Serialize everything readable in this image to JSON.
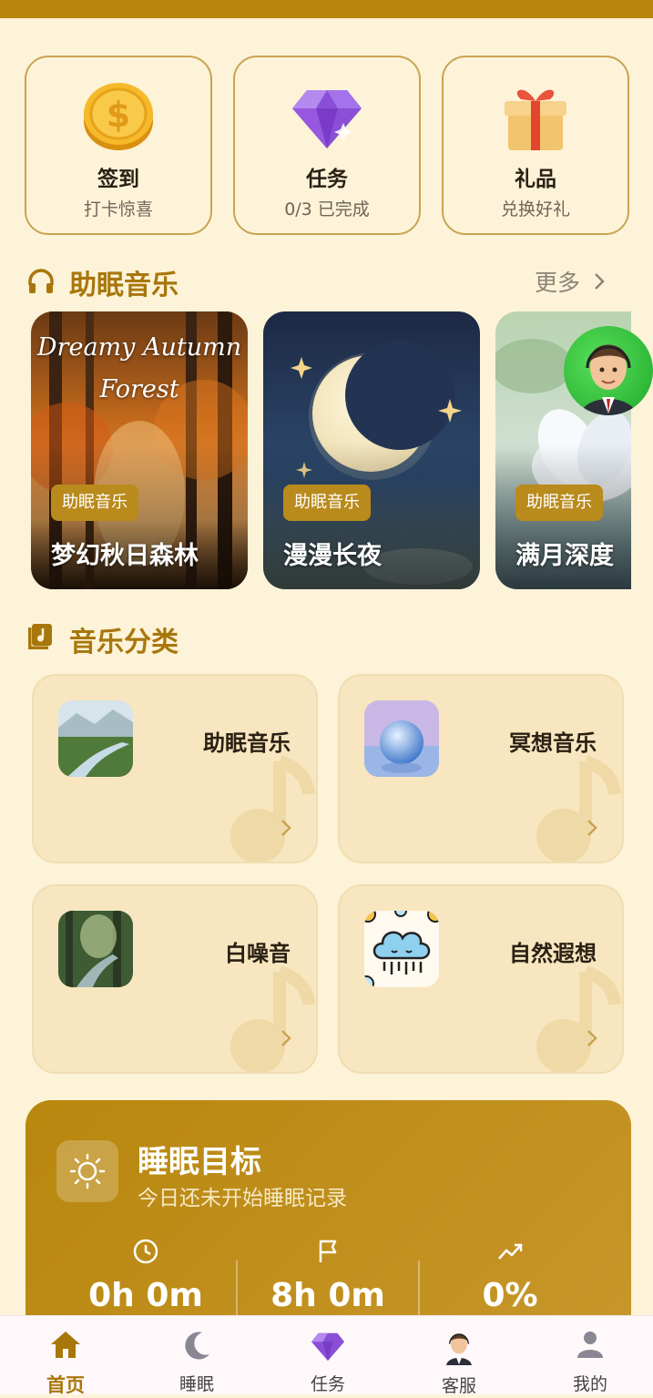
{
  "quick_actions": [
    {
      "title": "签到",
      "sub": "打卡惊喜",
      "icon": "coin-icon"
    },
    {
      "title": "任务",
      "sub": "0/3 已完成",
      "icon": "diamond-icon"
    },
    {
      "title": "礼品",
      "sub": "兑换好礼",
      "icon": "gift-icon"
    }
  ],
  "sleep_music": {
    "title": "助眠音乐",
    "more": "更多",
    "cards": [
      {
        "art_text_1": "Dreamy Autumn",
        "art_text_2": "Forest",
        "tag": "助眠音乐",
        "name": "梦幻秋日森林"
      },
      {
        "tag": "助眠音乐",
        "name": "漫漫长夜"
      },
      {
        "tag": "助眠音乐",
        "name": "满月深度"
      }
    ]
  },
  "categories": {
    "title": "音乐分类",
    "items": [
      {
        "label": "助眠音乐"
      },
      {
        "label": "冥想音乐"
      },
      {
        "label": "白噪音"
      },
      {
        "label": "自然遐想"
      }
    ]
  },
  "sleep_goal": {
    "title": "睡眠目标",
    "subtitle": "今日还未开始睡眠记录",
    "stats": [
      {
        "icon": "clock-icon",
        "value": "0h 0m"
      },
      {
        "icon": "flag-icon",
        "value": "8h 0m"
      },
      {
        "icon": "trend-icon",
        "value": "0%"
      }
    ]
  },
  "nav": [
    {
      "label": "首页",
      "icon": "home-icon",
      "active": true
    },
    {
      "label": "睡眠",
      "icon": "moon-icon"
    },
    {
      "label": "任务",
      "icon": "diamond-icon"
    },
    {
      "label": "客服",
      "icon": "agent-avatar-icon"
    },
    {
      "label": "我的",
      "icon": "person-icon"
    }
  ],
  "colors": {
    "accent": "#b8860b",
    "background": "#fdf3d8",
    "nav_active": "#a8770c"
  }
}
